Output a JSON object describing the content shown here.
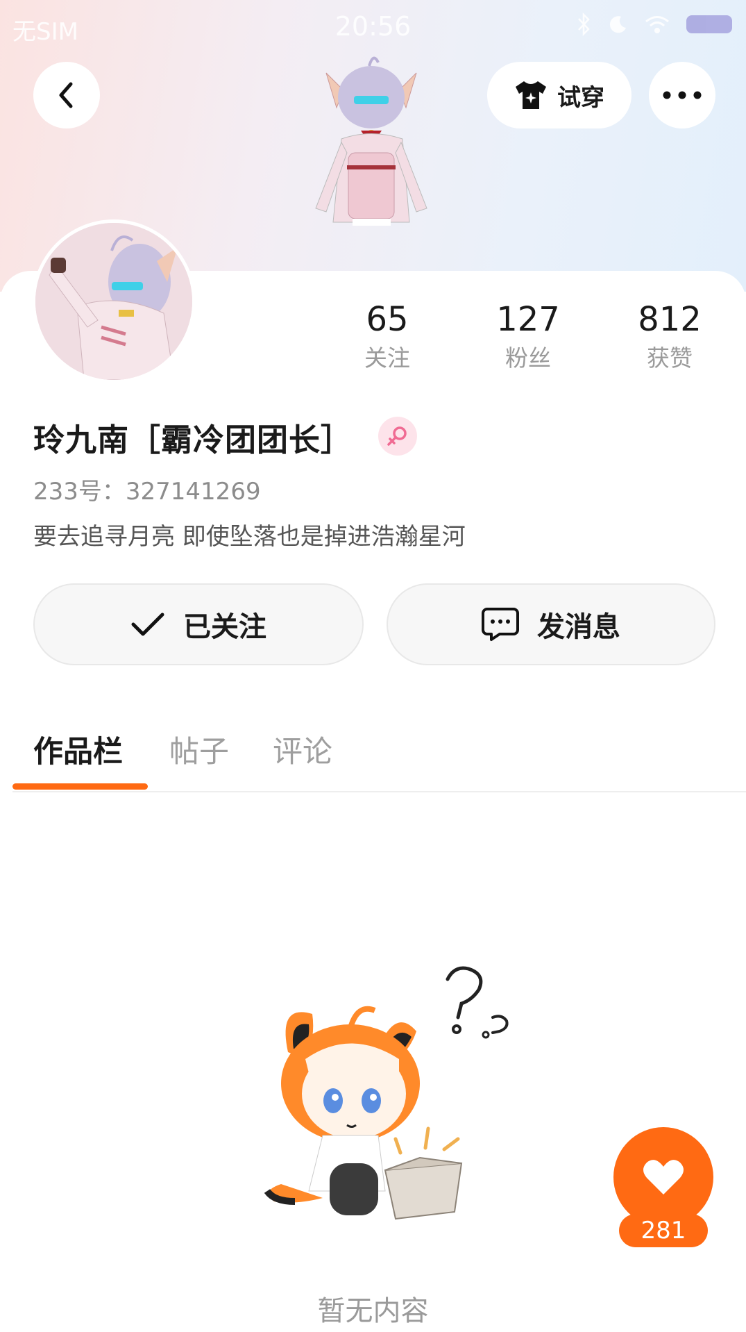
{
  "status_bar": {
    "carrier": "无SIM",
    "time": "20:56"
  },
  "header": {
    "try_on_label": "试穿"
  },
  "stats": [
    {
      "value": "65",
      "label": "关注"
    },
    {
      "value": "127",
      "label": "粉丝"
    },
    {
      "value": "812",
      "label": "获赞"
    }
  ],
  "profile": {
    "name": "玲九南［霸冷团团长］",
    "uid": "233号：327141269",
    "bio": "要去追寻月亮 即使坠落也是掉进浩瀚星河"
  },
  "actions": {
    "follow_label": "已关注",
    "message_label": "发消息"
  },
  "tabs": [
    {
      "label": "作品栏",
      "active": true
    },
    {
      "label": "帖子",
      "active": false
    },
    {
      "label": "评论",
      "active": false
    }
  ],
  "empty_state": {
    "text": "暂无内容"
  },
  "like": {
    "count": "281"
  },
  "colors": {
    "accent": "#ff6a13",
    "gender_icon": "#f06b93"
  }
}
